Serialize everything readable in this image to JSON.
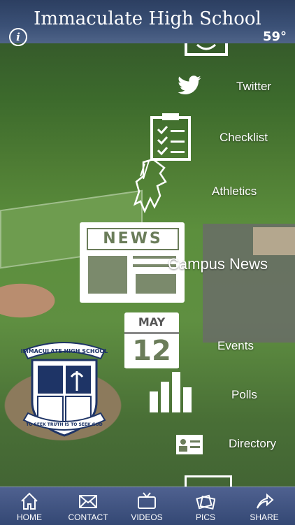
{
  "header": {
    "title": "Immaculate High School",
    "temperature": "59°"
  },
  "menu": {
    "twitter": "Twitter",
    "checklist": "Checklist",
    "athletics": "Athletics",
    "news_label": "Campus News",
    "news_badge": "NEWS",
    "events": "Events",
    "calendar_month": "MAY",
    "calendar_day": "12",
    "polls": "Polls",
    "directory": "Directory"
  },
  "crest": {
    "top_text": "IMMACULATE HIGH SCHOOL",
    "bottom_text": "TO SEEK TRUTH IS TO SEEK GOD"
  },
  "tabs": [
    {
      "label": "HOME",
      "icon": "home-icon"
    },
    {
      "label": "CONTACT",
      "icon": "envelope-icon"
    },
    {
      "label": "VIDEOS",
      "icon": "tv-icon"
    },
    {
      "label": "PICS",
      "icon": "photos-icon"
    },
    {
      "label": "SHARE",
      "icon": "share-icon"
    }
  ]
}
